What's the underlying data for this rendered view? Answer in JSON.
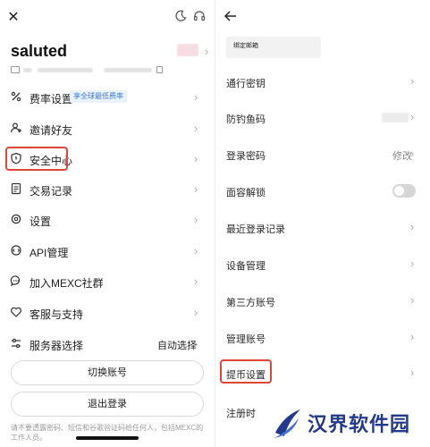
{
  "left": {
    "username": "saluted",
    "menu": [
      {
        "label": "费率设置",
        "icon": "percent-icon",
        "badge": "享全球最低费率"
      },
      {
        "label": "邀请好友",
        "icon": "add-user-icon"
      },
      {
        "label": "安全中心",
        "icon": "shield-icon"
      },
      {
        "label": "交易记录",
        "icon": "document-icon"
      },
      {
        "label": "设置",
        "icon": "gear-icon"
      },
      {
        "label": "API管理",
        "icon": "api-icon"
      },
      {
        "label": "加入MEXC社群",
        "icon": "chat-bubble-icon"
      },
      {
        "label": "客服与支持",
        "icon": "heart-handshake-icon"
      },
      {
        "label": "服务器选择",
        "icon": "sliders-icon",
        "value": "自动选择"
      }
    ],
    "switch_account_label": "切换账号",
    "logout_label": "退出登录",
    "footnote": "请不要透露密码、短信和谷歌验证码给任何人，包括MEXC的工作人员。"
  },
  "right": {
    "email_label": "绑定邮箱",
    "rows": [
      {
        "label": "通行密钥"
      },
      {
        "label": "防钓鱼码"
      },
      {
        "label": "登录密码",
        "value": "修改"
      },
      {
        "label": "面容解锁",
        "toggle": false
      },
      {
        "label": "最近登录记录"
      },
      {
        "label": "设备管理"
      },
      {
        "label": "第三方账号"
      },
      {
        "label": "管理账号"
      },
      {
        "label": "提币设置"
      },
      {
        "label": "注册时"
      }
    ]
  },
  "watermark": {
    "text": "汉界软件园"
  },
  "colors": {
    "highlight": "#e0453a",
    "badge_text": "#3a7bdf",
    "badge_bg": "#eaf2ff",
    "watermark": "#233a8c"
  }
}
